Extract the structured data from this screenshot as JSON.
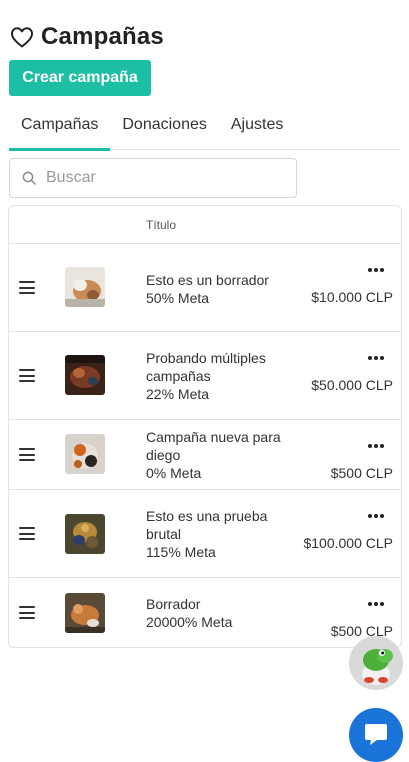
{
  "header": {
    "title": "Campañas",
    "icon": "heart-icon"
  },
  "actions": {
    "create_label": "Crear campaña"
  },
  "tabs": [
    {
      "label": "Campañas",
      "active": true
    },
    {
      "label": "Donaciones",
      "active": false
    },
    {
      "label": "Ajustes",
      "active": false
    }
  ],
  "search": {
    "placeholder": "Buscar",
    "value": ""
  },
  "table": {
    "column_title": "Título",
    "rows": [
      {
        "title": "Esto es un borrador",
        "goal": "50% Meta",
        "amount": "$10.000 CLP"
      },
      {
        "title": "Probando múltiples campañas",
        "goal": "22% Meta",
        "amount": "$50.000 CLP"
      },
      {
        "title": "Campaña nueva para diego",
        "goal": "0% Meta",
        "amount": "$500 CLP"
      },
      {
        "title": "Esto es una prueba brutal",
        "goal": "115% Meta",
        "amount": "$100.000 CLP"
      },
      {
        "title": "Borrador",
        "goal": "20000% Meta",
        "amount": "$500 CLP"
      }
    ]
  },
  "colors": {
    "accent": "#1cbfa3",
    "chat": "#1a73d9",
    "border": "#e2e2e2"
  }
}
